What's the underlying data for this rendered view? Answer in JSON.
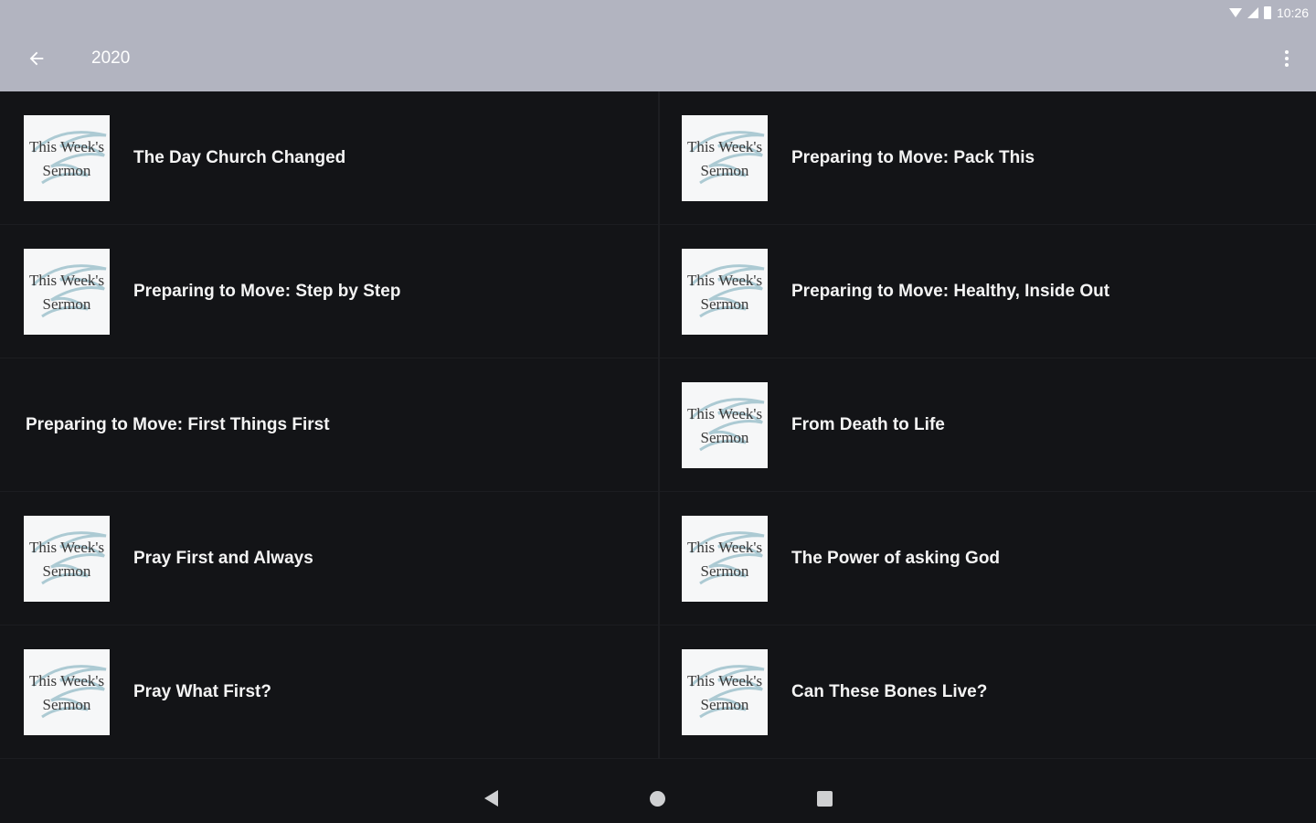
{
  "status_bar": {
    "time": "10:26"
  },
  "app_bar": {
    "title": "2020"
  },
  "thumbnail": {
    "line1": "This Week's",
    "line2": "Sermon"
  },
  "items": [
    {
      "title": "The Day Church Changed",
      "has_thumbnail": true
    },
    {
      "title": "Preparing to Move: Pack This",
      "has_thumbnail": true
    },
    {
      "title": "Preparing to Move: Step by Step",
      "has_thumbnail": true
    },
    {
      "title": "Preparing to Move: Healthy, Inside Out",
      "has_thumbnail": true
    },
    {
      "title": "Preparing to Move: First Things First",
      "has_thumbnail": false
    },
    {
      "title": "From Death to Life",
      "has_thumbnail": true
    },
    {
      "title": "Pray First and Always",
      "has_thumbnail": true
    },
    {
      "title": "The Power of asking God",
      "has_thumbnail": true
    },
    {
      "title": "Pray What First?",
      "has_thumbnail": true
    },
    {
      "title": "Can These Bones Live?",
      "has_thumbnail": true
    }
  ],
  "colors": {
    "app_bar": "#b2b4c0",
    "background": "#131417",
    "text": "#f4f4f4"
  }
}
